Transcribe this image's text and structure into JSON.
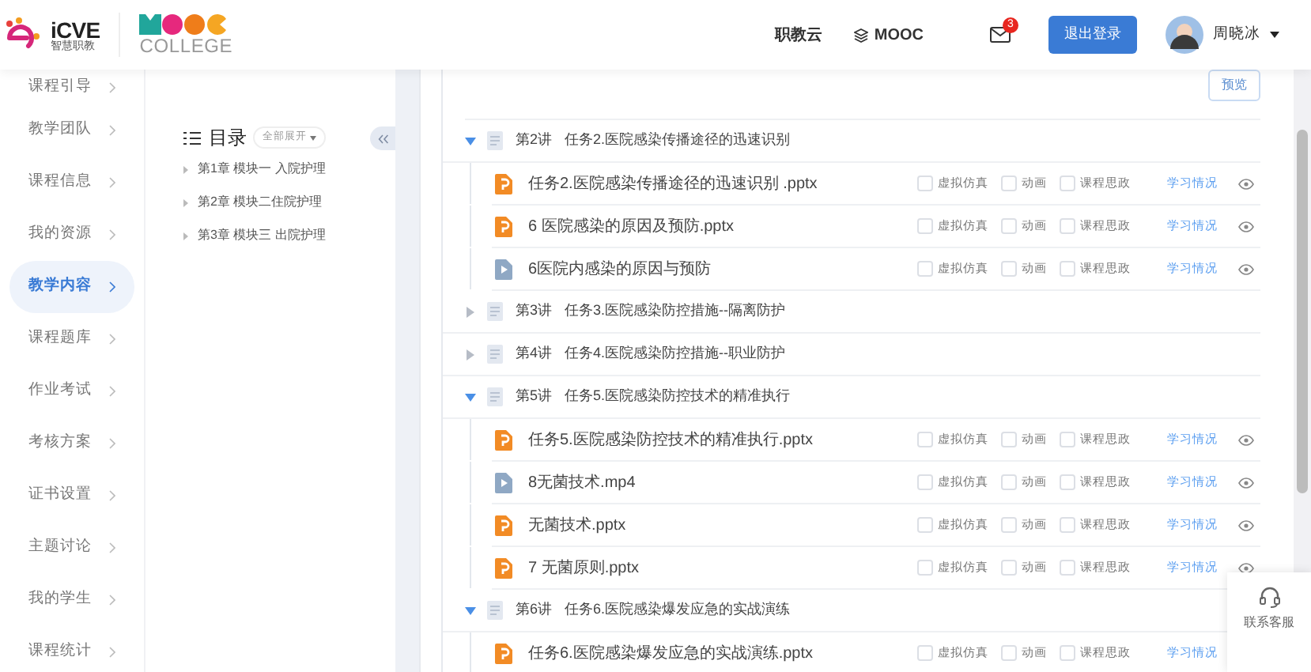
{
  "header": {
    "logo_icve": {
      "brand": "iCVE",
      "subtitle": "智慧职教"
    },
    "logo_mooc": {
      "brand": "COLLEGE"
    },
    "nav": [
      {
        "label": "职教云",
        "kind": "text"
      },
      {
        "label": "MOOC",
        "kind": "mooc"
      }
    ],
    "mail_badge": "3",
    "logout": "退出登录",
    "user": "周晓冰"
  },
  "sidebar": {
    "items": [
      {
        "label": "课程引导",
        "selected": false
      },
      {
        "label": "教学团队",
        "selected": false
      },
      {
        "label": "课程信息",
        "selected": false
      },
      {
        "label": "我的资源",
        "selected": false
      },
      {
        "label": "教学内容",
        "selected": true
      },
      {
        "label": "课程题库",
        "selected": false
      },
      {
        "label": "作业考试",
        "selected": false
      },
      {
        "label": "考核方案",
        "selected": false
      },
      {
        "label": "证书设置",
        "selected": false
      },
      {
        "label": "主题讨论",
        "selected": false
      },
      {
        "label": "我的学生",
        "selected": false
      },
      {
        "label": "课程统计",
        "selected": false
      }
    ]
  },
  "toc": {
    "title": "目录",
    "expand_all": "全部展开",
    "chapters": [
      {
        "label": "第1章 模块一 入院护理"
      },
      {
        "label": "第2章 模块二住院护理"
      },
      {
        "label": "第3章 模块三 出院护理"
      }
    ]
  },
  "preview_button": "预览",
  "lectures": [
    {
      "number": "第2讲",
      "title": "任务2.医院感染传播途径的迅速识别",
      "expanded": true,
      "children": [
        {
          "kind": "pptx",
          "name": "任务2.医院感染传播途径的迅速识别 .pptx",
          "eye": true,
          "checks": [
            {
              "label": "虚拟仿真",
              "checked": false
            },
            {
              "label": "动画",
              "checked": false
            },
            {
              "label": "课程思政",
              "checked": false
            }
          ],
          "link": "学习情况"
        },
        {
          "kind": "pptx",
          "name": "6 医院感染的原因及预防.pptx",
          "eye": true,
          "checks": [
            {
              "label": "虚拟仿真",
              "checked": false
            },
            {
              "label": "动画",
              "checked": false
            },
            {
              "label": "课程思政",
              "checked": false
            }
          ],
          "link": "学习情况"
        },
        {
          "kind": "mp4",
          "name": "6医院内感染的原因与预防",
          "eye": true,
          "checks": [
            {
              "label": "虚拟仿真",
              "checked": false
            },
            {
              "label": "动画",
              "checked": false
            },
            {
              "label": "课程思政",
              "checked": false
            }
          ],
          "link": "学习情况"
        }
      ]
    },
    {
      "number": "第3讲",
      "title": "任务3.医院感染防控措施--隔离防护",
      "expanded": false
    },
    {
      "number": "第4讲",
      "title": "任务4.医院感染防控措施--职业防护",
      "expanded": false
    },
    {
      "number": "第5讲",
      "title": "任务5.医院感染防控技术的精准执行",
      "expanded": true,
      "children": [
        {
          "kind": "pptx",
          "name": "任务5.医院感染防控技术的精准执行.pptx",
          "eye": true,
          "checks": [
            {
              "label": "虚拟仿真",
              "checked": false
            },
            {
              "label": "动画",
              "checked": false
            },
            {
              "label": "课程思政",
              "checked": false
            }
          ],
          "link": "学习情况"
        },
        {
          "kind": "mp4",
          "name": "8无菌技术.mp4",
          "eye": true,
          "checks": [
            {
              "label": "虚拟仿真",
              "checked": false
            },
            {
              "label": "动画",
              "checked": false
            },
            {
              "label": "课程思政",
              "checked": false
            }
          ],
          "link": "学习情况"
        },
        {
          "kind": "pptx",
          "name": "无菌技术.pptx",
          "eye": true,
          "checks": [
            {
              "label": "虚拟仿真",
              "checked": false
            },
            {
              "label": "动画",
              "checked": false
            },
            {
              "label": "课程思政",
              "checked": false
            }
          ],
          "link": "学习情况"
        },
        {
          "kind": "pptx",
          "name": "7 无菌原则.pptx",
          "eye": true,
          "checks": [
            {
              "label": "虚拟仿真",
              "checked": false
            },
            {
              "label": "动画",
              "checked": false
            },
            {
              "label": "课程思政",
              "checked": false
            }
          ],
          "link": "学习情况"
        }
      ]
    },
    {
      "number": "第6讲",
      "title": "任务6.医院感染爆发应急的实战演练",
      "expanded": true,
      "children": [
        {
          "kind": "pptx",
          "name": "任务6.医院感染爆发应急的实战演练.pptx",
          "eye": false,
          "checks": [
            {
              "label": "虚拟仿真",
              "checked": false
            },
            {
              "label": "动画",
              "checked": false
            },
            {
              "label": "课程思政",
              "checked": false
            }
          ],
          "link": "学习情况"
        }
      ]
    }
  ],
  "support_widget": {
    "label": "联系客服"
  }
}
